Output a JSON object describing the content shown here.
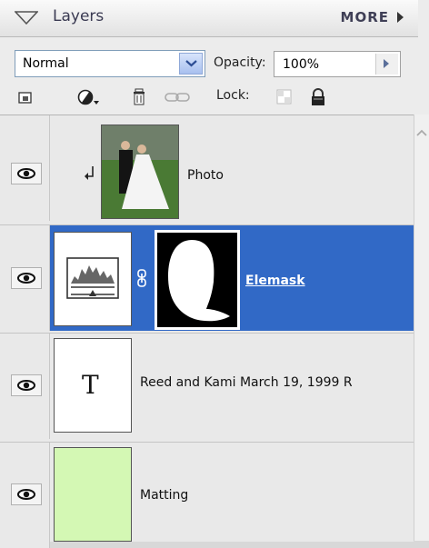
{
  "header": {
    "title": "Layers",
    "more_label": "MORE"
  },
  "controls": {
    "blend_mode": "Normal",
    "opacity_label": "Opacity:",
    "opacity_value": "100%",
    "lock_label": "Lock:"
  },
  "toolbar_icons": [
    "new-layer-icon",
    "adjustment-layer-icon",
    "trash-icon",
    "link-icon",
    "lock-transparency-icon",
    "lock-all-icon"
  ],
  "layers": [
    {
      "name": "Photo",
      "type": "image",
      "clipped": true,
      "visible": true,
      "selected": false
    },
    {
      "name": "Elemask",
      "type": "adjustment",
      "mask": true,
      "visible": true,
      "selected": true
    },
    {
      "name": "Reed and Kami March 19, 1999 R",
      "type": "text",
      "thumb_glyph": "T",
      "visible": true,
      "selected": false
    },
    {
      "name": "Matting",
      "type": "fill",
      "fill_color": "#d4f8b4",
      "visible": true,
      "selected": false
    }
  ],
  "colors": {
    "selection": "#3169c6",
    "panel_bg": "#ececec"
  }
}
